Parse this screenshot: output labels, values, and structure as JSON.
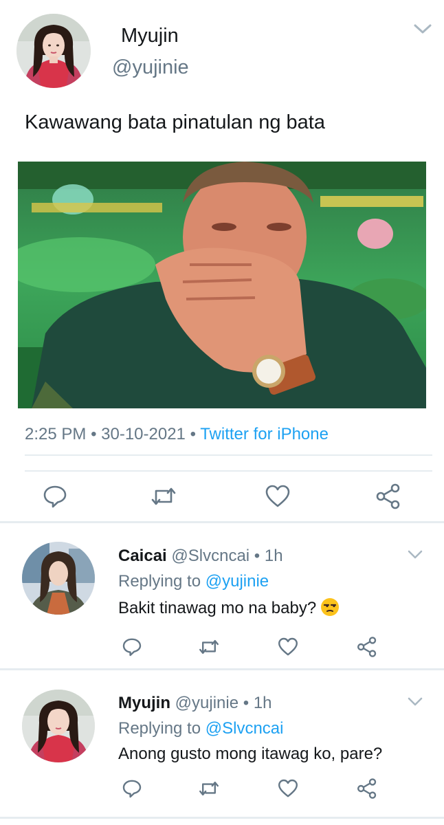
{
  "tweet": {
    "author_name": "Myujin",
    "author_handle": "@yujinie",
    "text": "Kawawang bata pinatulan ng bata",
    "time": "2:25 PM",
    "date": "30-10-2021",
    "separator": "•",
    "source": "Twitter for iPhone",
    "actions": [
      "reply-icon",
      "retweet-icon",
      "like-icon",
      "share-icon"
    ]
  },
  "replies": [
    {
      "name": "Caicai",
      "handle": "@Slvcncai",
      "dot": "•",
      "time": "1h",
      "replying_prefix": "Replying to",
      "replying_mention": "@yujinie",
      "text": "Bakit tinawag mo na baby?",
      "emoji": "unamused-face-emoji"
    },
    {
      "name": "Myujin",
      "handle": "@yujinie",
      "dot": "•",
      "time": "1h",
      "replying_prefix": "Replying to",
      "replying_mention": "@Slvcncai",
      "text": "Anong gusto mong itawag ko, pare?"
    }
  ],
  "colors": {
    "text": "#14171a",
    "secondary": "#657786",
    "accent": "#1da1f2",
    "divider": "#e6ecf0",
    "icon": "#657786"
  }
}
